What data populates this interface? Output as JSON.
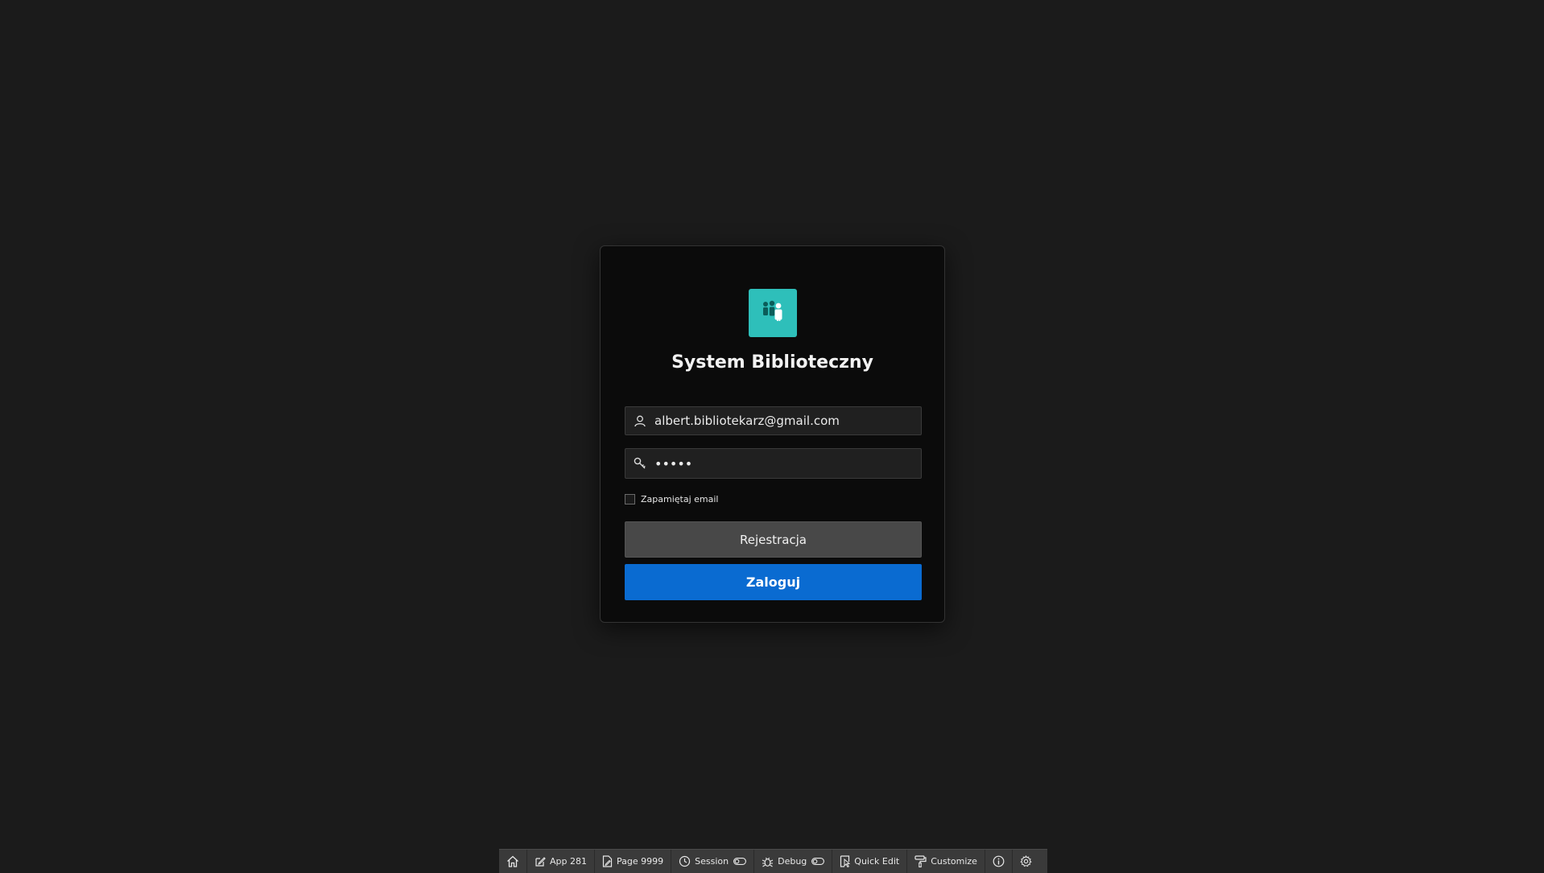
{
  "login": {
    "title": "System Biblioteczny",
    "logo_icon": "users-icon",
    "logo_color": "#2ebfba",
    "email": {
      "value": "albert.bibliotekarz@gmail.com",
      "icon": "user-icon"
    },
    "password": {
      "value": "•••••",
      "icon": "key-icon"
    },
    "remember_label": "Zapamiętaj email",
    "remember_checked": false,
    "register_label": "Rejestracja",
    "login_label": "Zaloguj",
    "login_color": "#0a6bd1"
  },
  "devbar": {
    "home_icon": "home-icon",
    "app_label": "App 281",
    "page_label": "Page 9999",
    "session_label": "Session",
    "debug_label": "Debug",
    "quick_edit_label": "Quick Edit",
    "customize_label": "Customize",
    "info_icon": "info-icon",
    "settings_icon": "gear-icon"
  }
}
